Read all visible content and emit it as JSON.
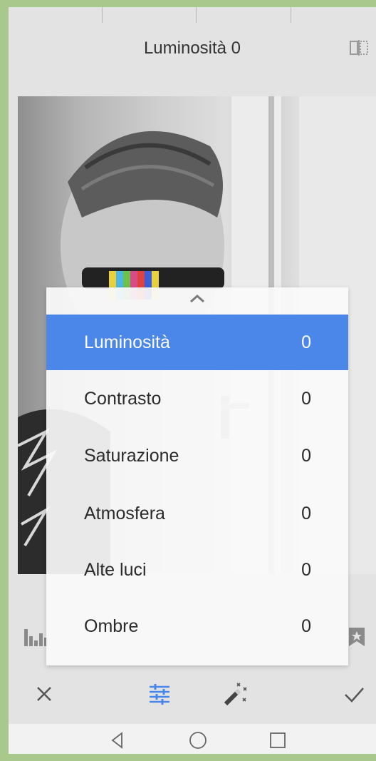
{
  "header": {
    "title": "Luminosità 0"
  },
  "icons": {
    "compare": "compare-split-icon",
    "histogram": "histogram-icon",
    "bookmark": "bookmark-star-icon",
    "collapse": "chevron-up-icon",
    "close": "close-icon",
    "tune": "tune-sliders-icon",
    "magic": "magic-wand-icon",
    "confirm": "check-icon",
    "nav_back": "triangle-back-icon",
    "nav_home": "circle-home-icon",
    "nav_recents": "square-recents-icon"
  },
  "adjustments": {
    "items": [
      {
        "label": "Luminosità",
        "value": "0",
        "selected": true
      },
      {
        "label": "Contrasto",
        "value": "0",
        "selected": false
      },
      {
        "label": "Saturazione",
        "value": "0",
        "selected": false
      },
      {
        "label": "Atmosfera",
        "value": "0",
        "selected": false
      },
      {
        "label": "Alte luci",
        "value": "0",
        "selected": false
      },
      {
        "label": "Ombre",
        "value": "0",
        "selected": false
      }
    ]
  },
  "colors": {
    "accent": "#4a87e8",
    "background": "#e3e3e3",
    "outer_frame": "#a8c98b"
  }
}
